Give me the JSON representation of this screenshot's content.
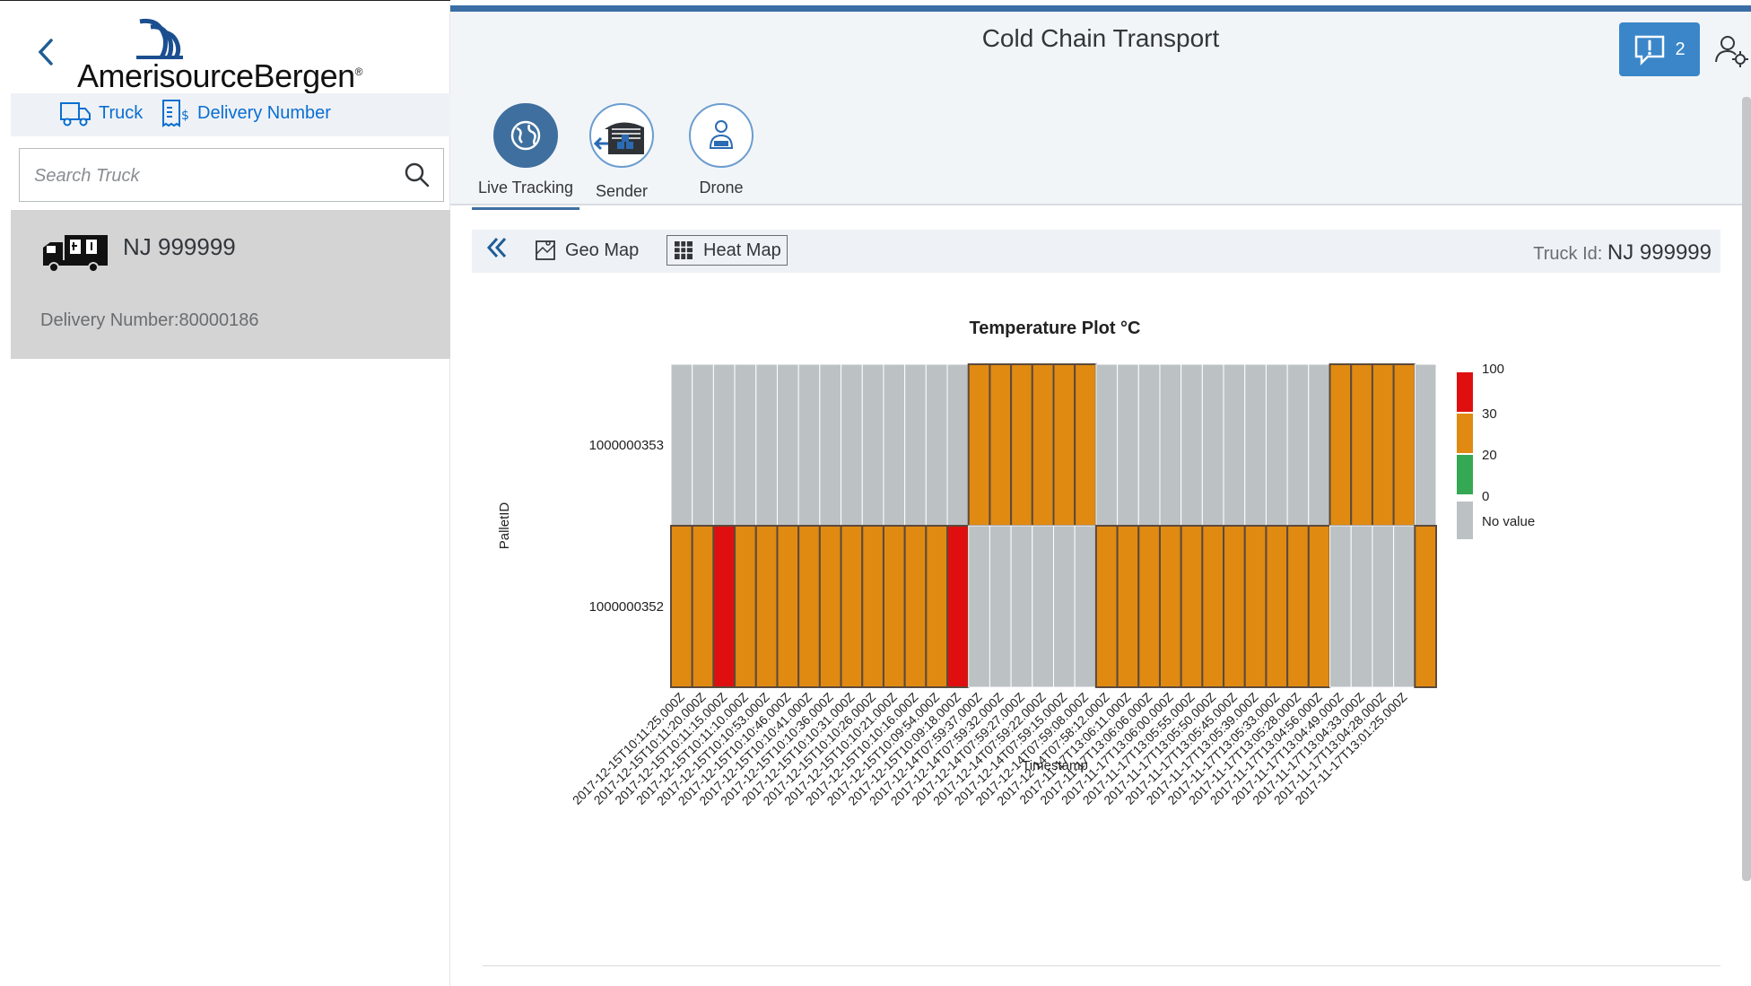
{
  "master": {
    "logo_text": "AmerisourceBergen",
    "logo_reg": "®",
    "tabs": [
      {
        "label": "Truck",
        "icon": "truck-icon"
      },
      {
        "label": "Delivery Number",
        "icon": "invoice-icon"
      }
    ],
    "search_placeholder": "Search Truck",
    "items": [
      {
        "title": "NJ 999999",
        "description": "Delivery Number:80000186",
        "icon": "truck-icon"
      }
    ]
  },
  "header": {
    "title": "Cold Chain Transport",
    "notifications_count": "2",
    "accent": "#3a86c9"
  },
  "icon_tabs": [
    {
      "label": "Live Tracking",
      "icon": "globe-icon",
      "selected": true
    },
    {
      "label": "Sender",
      "icon": "warehouse-icon",
      "selected": false
    },
    {
      "label": "Drone",
      "icon": "operator-icon",
      "selected": false
    }
  ],
  "toolbar": {
    "geo_map_label": "Geo Map",
    "heat_map_label": "Heat Map",
    "truck_id_label": "Truck Id:",
    "truck_id_value": "NJ 999999"
  },
  "chart_data": {
    "type": "heatmap",
    "title": "Temperature Plot °C",
    "xlabel": "Timestamp",
    "ylabel": "PalletID",
    "rows": [
      "1000000353",
      "1000000352"
    ],
    "timestamps": [
      "2017-12-15T10:11:25.000Z",
      "2017-12-15T10:11:20.000Z",
      "2017-12-15T10:11:15.000Z",
      "2017-12-15T10:11:10.000Z",
      "2017-12-15T10:10:53.000Z",
      "2017-12-15T10:10:46.000Z",
      "2017-12-15T10:10:41.000Z",
      "2017-12-15T10:10:36.000Z",
      "2017-12-15T10:10:31.000Z",
      "2017-12-15T10:10:26.000Z",
      "2017-12-15T10:10:21.000Z",
      "2017-12-15T10:10:16.000Z",
      "2017-12-15T10:09:54.000Z",
      "2017-12-15T10:09:18.000Z",
      "2017-12-14T07:59:37.000Z",
      "2017-12-14T07:59:32.000Z",
      "2017-12-14T07:59:27.000Z",
      "2017-12-14T07:59:22.000Z",
      "2017-12-14T07:59:15.000Z",
      "2017-12-14T07:59:08.000Z",
      "2017-12-14T07:58:12.000Z",
      "2017-11-17T13:06:11.000Z",
      "2017-11-17T13:06:06.000Z",
      "2017-11-17T13:06:00.000Z",
      "2017-11-17T13:05:55.000Z",
      "2017-11-17T13:05:50.000Z",
      "2017-11-17T13:05:45.000Z",
      "2017-11-17T13:05:39.000Z",
      "2017-11-17T13:05:33.000Z",
      "2017-11-17T13:05:28.000Z",
      "2017-11-17T13:04:56.000Z",
      "2017-11-17T13:04:49.000Z",
      "2017-11-17T13:04:33.000Z",
      "2017-11-17T13:04:28.000Z",
      "2017-11-17T13:01:25.000Z"
    ],
    "cells": [
      [
        "none",
        "none",
        "none",
        "none",
        "none",
        "none",
        "none",
        "none",
        "none",
        "none",
        "none",
        "none",
        "none",
        "none",
        "20-30",
        "20-30",
        "20-30",
        "20-30",
        "20-30",
        "20-30",
        "none",
        "none",
        "none",
        "none",
        "none",
        "none",
        "none",
        "none",
        "none",
        "none",
        "none",
        "20-30",
        "20-30",
        "20-30",
        "20-30",
        "none"
      ],
      [
        "20-30",
        "20-30",
        "30-100",
        "20-30",
        "20-30",
        "20-30",
        "20-30",
        "20-30",
        "20-30",
        "20-30",
        "20-30",
        "20-30",
        "20-30",
        "30-100",
        "none",
        "none",
        "none",
        "none",
        "none",
        "none",
        "20-30",
        "20-30",
        "20-30",
        "20-30",
        "20-30",
        "20-30",
        "20-30",
        "20-30",
        "20-30",
        "20-30",
        "20-30",
        "none",
        "none",
        "none",
        "none",
        "20-30"
      ]
    ],
    "legend": {
      "ticks": [
        "100",
        "30",
        "20",
        "0"
      ],
      "bands": [
        {
          "range": "30-100",
          "color": "#e00f0f"
        },
        {
          "range": "20-30",
          "color": "#e08a12"
        },
        {
          "range": "0-20",
          "color": "#34a853"
        }
      ],
      "no_value_label": "No value",
      "no_value_color": "#bcc1c4",
      "placement": "right"
    },
    "cell_border_color": "#5c4a3a"
  }
}
